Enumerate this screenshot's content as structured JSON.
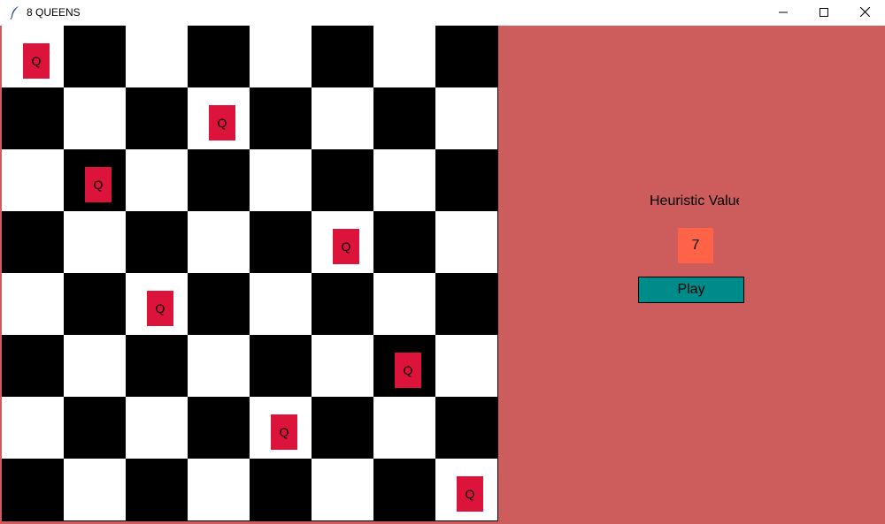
{
  "window": {
    "title": "8 QUEENS",
    "controls": {
      "minimize_icon": "minimize-icon",
      "maximize_icon": "maximize-icon",
      "close_icon": "close-icon"
    }
  },
  "colors": {
    "background": "#cd5c5c",
    "dark_square": "#000000",
    "light_square": "#ffffff",
    "queen": "#dc143c",
    "heuristic_box": "#ff6347",
    "play_button": "#008b8b"
  },
  "board": {
    "size": 8,
    "queen_label": "Q",
    "queens_by_row": [
      0,
      3,
      1,
      5,
      2,
      6,
      4,
      7
    ]
  },
  "panel": {
    "heuristic_label": "Heuristic Value",
    "heuristic_value": "7",
    "play_label": "Play"
  }
}
